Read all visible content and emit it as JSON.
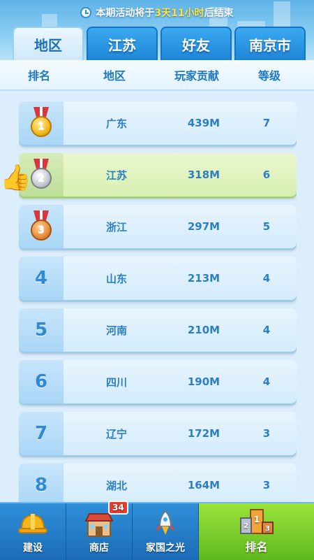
{
  "notice": {
    "prefix": "本期活动将于",
    "highlight": "3天11小时",
    "suffix": "后结束"
  },
  "tabs": [
    {
      "label": "地区",
      "active": true
    },
    {
      "label": "江苏",
      "active": false
    },
    {
      "label": "好友",
      "active": false
    },
    {
      "label": "南京市",
      "active": false
    }
  ],
  "columns": {
    "rank": "排名",
    "region": "地区",
    "contribution": "玩家贡献",
    "level": "等级"
  },
  "rows": [
    {
      "rank": "1",
      "medal": "gold-medal-icon",
      "region": "广东",
      "contribution": "439M",
      "level": "7"
    },
    {
      "rank": "2",
      "medal": "silver-medal-icon",
      "region": "江苏",
      "contribution": "318M",
      "level": "6",
      "highlighted": true
    },
    {
      "rank": "3",
      "medal": "bronze-medal-icon",
      "region": "浙江",
      "contribution": "297M",
      "level": "5"
    },
    {
      "rank": "4",
      "region": "山东",
      "contribution": "213M",
      "level": "4"
    },
    {
      "rank": "5",
      "region": "河南",
      "contribution": "210M",
      "level": "4"
    },
    {
      "rank": "6",
      "region": "四川",
      "contribution": "190M",
      "level": "4"
    },
    {
      "rank": "7",
      "region": "辽宁",
      "contribution": "172M",
      "level": "3"
    },
    {
      "rank": "8",
      "region": "湖北",
      "contribution": "164M",
      "level": "3"
    }
  ],
  "bottom_nav": {
    "build": "建设",
    "shop": "商店",
    "shop_badge": "34",
    "glory": "家国之光",
    "ranking": "排名"
  },
  "colors": {
    "accent": "#1f86d8",
    "highlight_row": "#d8efb1",
    "notice_highlight": "#ffe23a",
    "active_nav": "#7fd42c"
  }
}
